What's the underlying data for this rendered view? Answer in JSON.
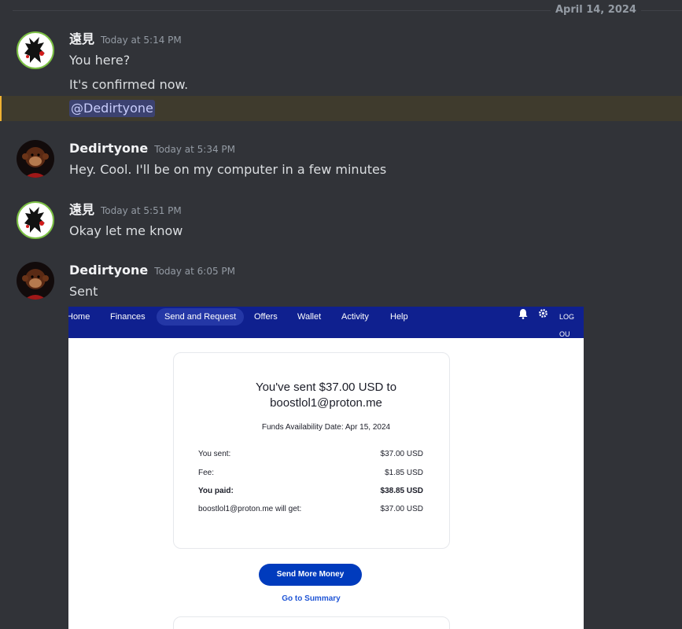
{
  "date_divider": "April 14, 2024",
  "messages": [
    {
      "user": "遠見",
      "time": "Today at 5:14 PM",
      "lines": [
        "You here?",
        "It's confirmed now."
      ],
      "mention": "@Dedirtyone"
    },
    {
      "user": "Dedirtyone",
      "time": "Today at 5:34 PM",
      "lines": [
        "Hey. Cool. I'll be on my computer in a few minutes"
      ]
    },
    {
      "user": "遠見",
      "time": "Today at 5:51 PM",
      "lines": [
        "Okay let me know"
      ]
    },
    {
      "user": "Dedirtyone",
      "time": "Today at 6:05 PM",
      "lines": [
        "Sent"
      ]
    }
  ],
  "colors": {
    "background": "#313338",
    "mention_highlight": "#f0b232",
    "nav_blue": "#0f208f",
    "button_blue": "#003bbd"
  },
  "attachment": {
    "nav": [
      "Home",
      "Finances",
      "Send and Request",
      "Offers",
      "Wallet",
      "Activity",
      "Help"
    ],
    "icons": [
      "bell-icon",
      "gear-icon"
    ],
    "logout": "LOG OU",
    "title_line1": "You've sent $37.00 USD to",
    "title_line2": "boostlol1@proton.me",
    "availability": "Funds Availability Date: Apr 15, 2024",
    "rows": [
      {
        "label": "You sent:",
        "value": "$37.00 USD"
      },
      {
        "label": "Fee:",
        "value": "$1.85 USD"
      },
      {
        "label": "You paid:",
        "value": "$38.85 USD"
      },
      {
        "label": "boostlol1@proton.me will get:",
        "value": "$37.00 USD"
      }
    ],
    "button": "Send More Money",
    "link": "Go to Summary"
  }
}
